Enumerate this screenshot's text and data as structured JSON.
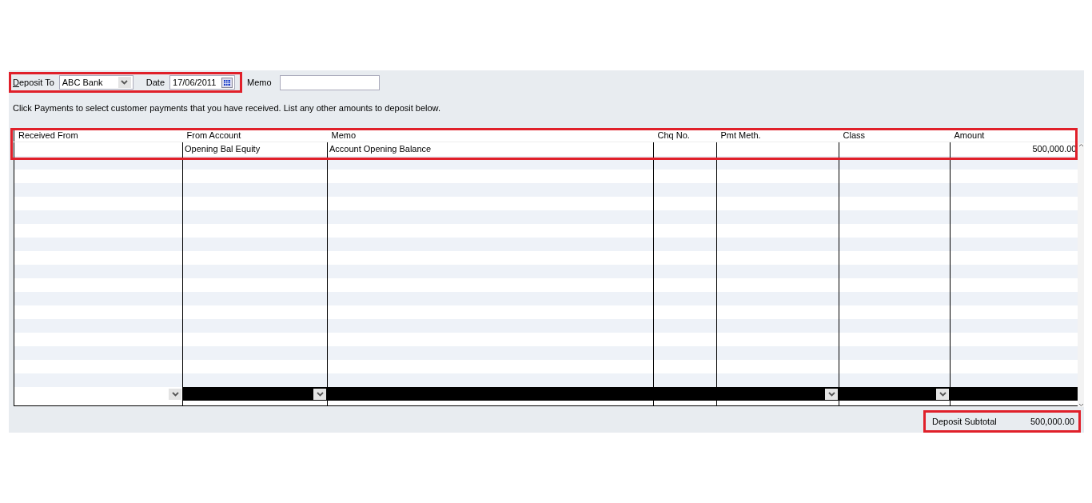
{
  "deposit_to": {
    "label": "Deposit To",
    "value": "ABC Bank"
  },
  "date": {
    "label": "Date",
    "value": "17/06/2011"
  },
  "memo": {
    "label": "Memo"
  },
  "instruction": "Click Payments to select customer payments that you have received. List any other amounts to deposit below.",
  "table": {
    "columns": [
      {
        "label": "Received From",
        "kind": "text",
        "dropdown": true
      },
      {
        "label": "From Account",
        "kind": "text",
        "dropdown": true
      },
      {
        "label": "Memo",
        "kind": "text",
        "dropdown": false
      },
      {
        "label": "Chq No.",
        "kind": "text",
        "dropdown": false
      },
      {
        "label": "Pmt Meth.",
        "kind": "text",
        "dropdown": true
      },
      {
        "label": "Class",
        "kind": "text",
        "dropdown": true
      },
      {
        "label": "Amount",
        "kind": "amount",
        "dropdown": false
      }
    ],
    "rows": [
      {
        "from_account": "Opening Bal Equity",
        "memo": "Account Opening Balance",
        "amount": "500,000.00"
      }
    ]
  },
  "subtotal": {
    "label": "Deposit Subtotal",
    "value": "500,000.00"
  }
}
